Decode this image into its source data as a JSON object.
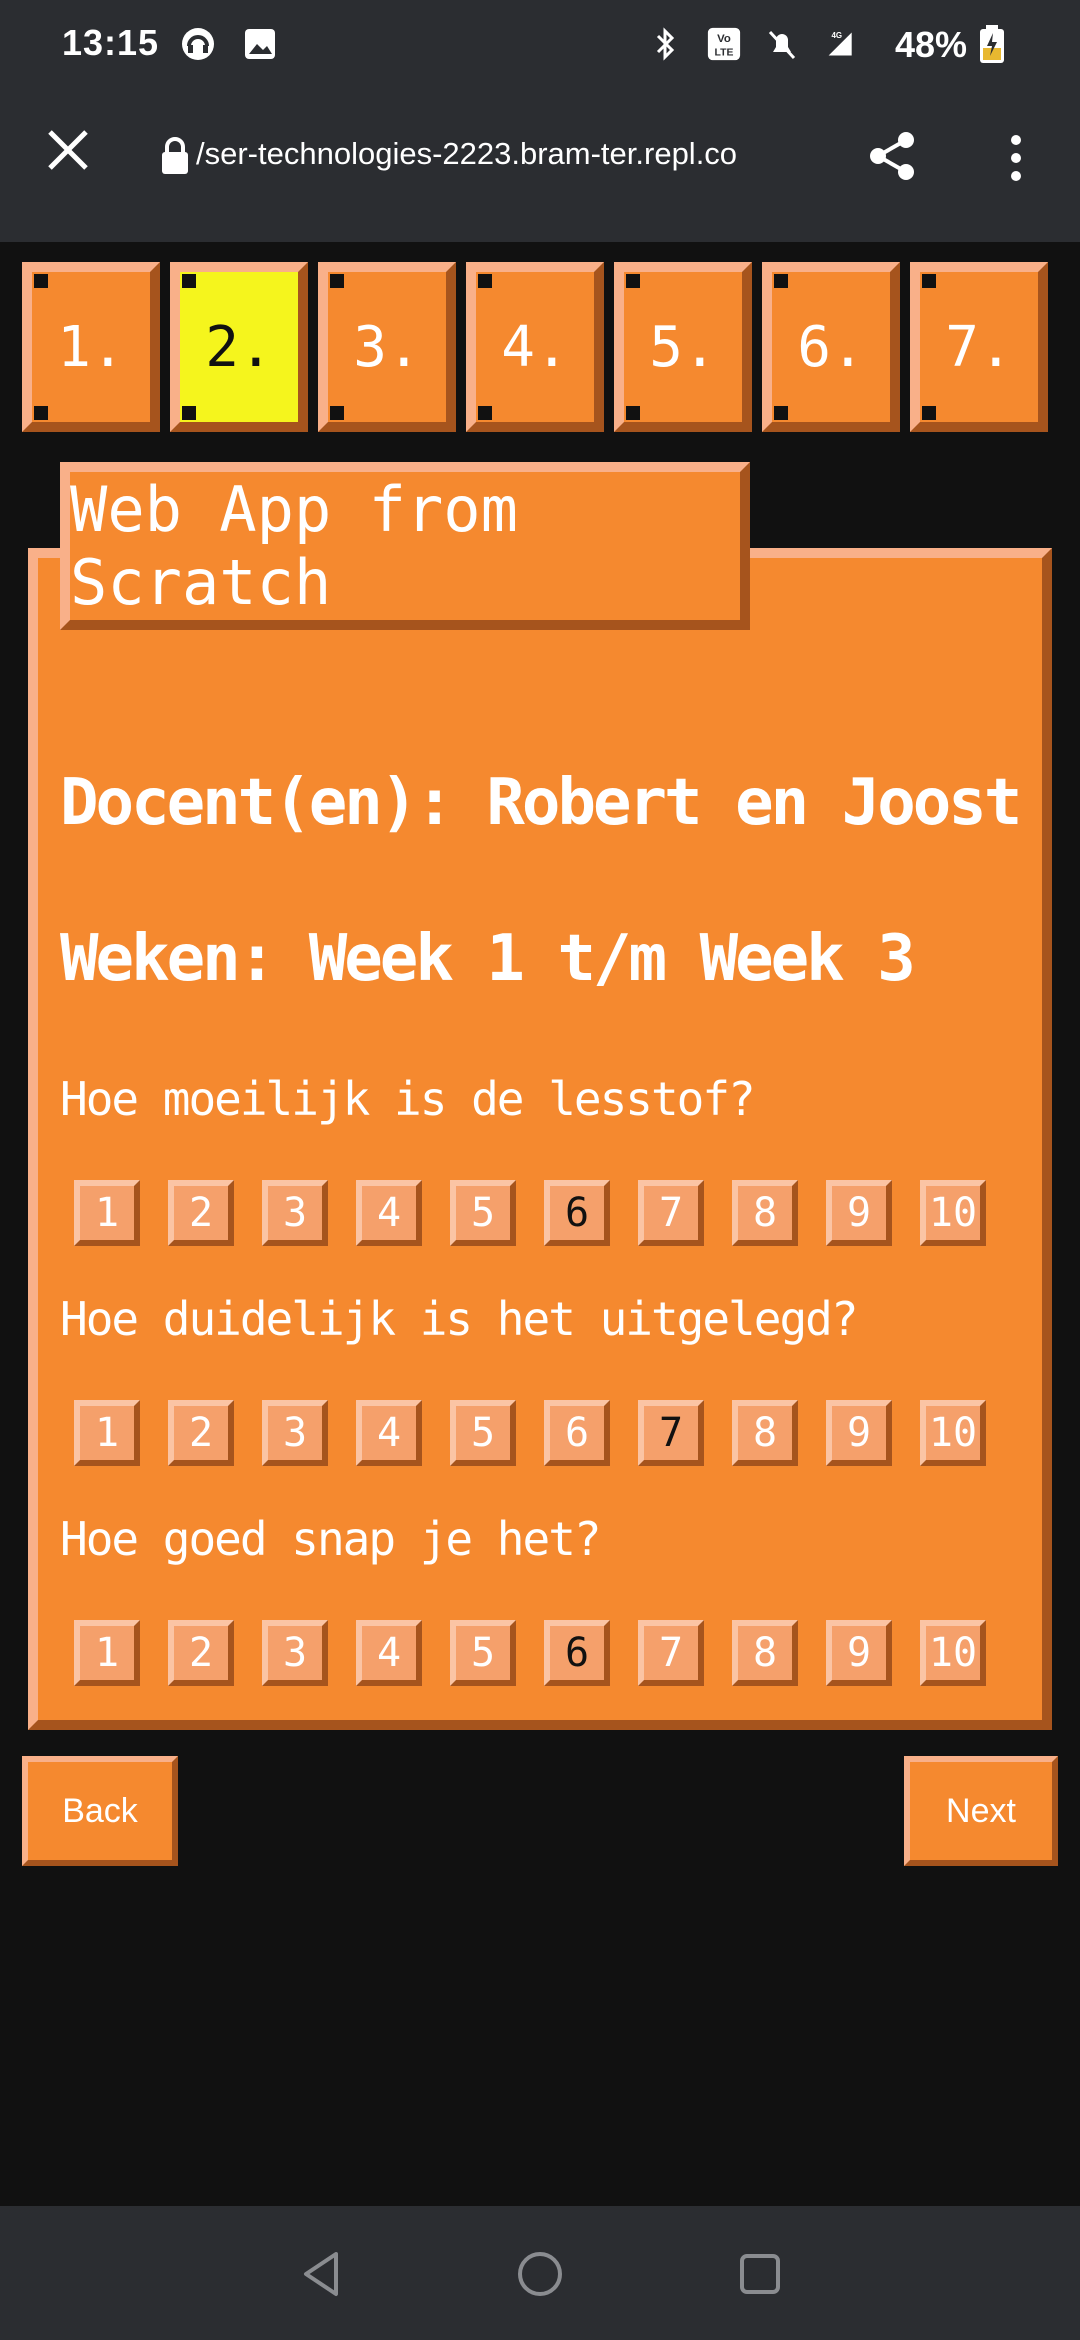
{
  "status_bar": {
    "time": "13:15",
    "battery": "48%",
    "icons": [
      "headset-icon",
      "image-icon",
      "bluetooth-icon",
      "volte-icon",
      "mute-icon",
      "signal-4g-icon",
      "battery-charging-icon"
    ]
  },
  "browser": {
    "url": "​/ser-technologies-2223.bram-ter.repl.co"
  },
  "tabs": [
    "1.",
    "2.",
    "3.",
    "4.",
    "5.",
    "6.",
    "7."
  ],
  "active_tab": "2.",
  "panel": {
    "title": "Web App from Scratch",
    "docent": "Docent(en): Robert en Joost",
    "weken": "Weken: Week 1 t/m Week 3"
  },
  "questions": [
    {
      "text": "Hoe moeilijk is de lesstof?",
      "selected": 6
    },
    {
      "text": "Hoe duidelijk is het uitgelegd?",
      "selected": 7
    },
    {
      "text": "Hoe goed snap je het?",
      "selected": 6
    }
  ],
  "rating_values": [
    "1",
    "2",
    "3",
    "4",
    "5",
    "6",
    "7",
    "8",
    "9",
    "10"
  ],
  "nav": {
    "back": "Back",
    "next": "Next"
  },
  "colors": {
    "accent": "#f5892f",
    "highlight": "#f5f51d",
    "light_edge": "#f9b089",
    "dark_edge": "#a6541d",
    "background": "#111111"
  }
}
